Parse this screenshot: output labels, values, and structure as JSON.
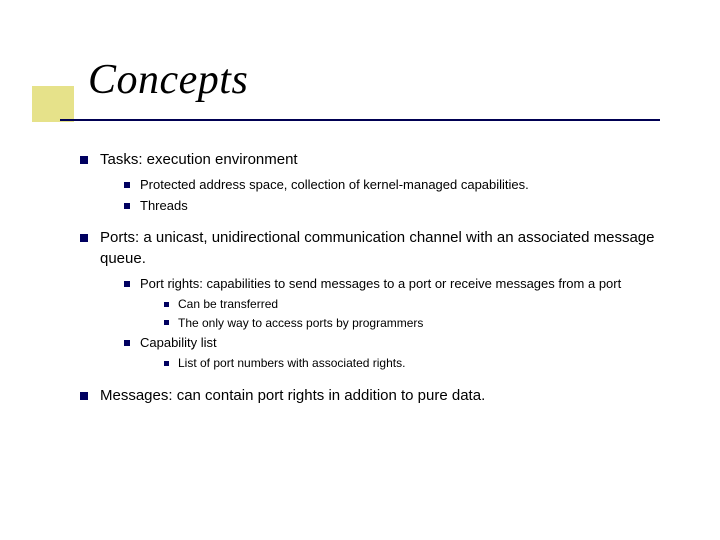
{
  "title": "Concepts",
  "b1": "Tasks: execution environment",
  "b1_1": "Protected address space, collection of kernel-managed capabilities.",
  "b1_2": "Threads",
  "b2": "Ports: a unicast, unidirectional communication channel with an associated message queue.",
  "b2_1": "Port rights: capabilities to send messages to a port or receive messages from a port",
  "b2_1_1": "Can be transferred",
  "b2_1_2": "The only way to access ports by programmers",
  "b2_2": "Capability list",
  "b2_2_1": "List of port numbers with associated rights.",
  "b3": "Messages: can contain port rights in addition to pure data."
}
